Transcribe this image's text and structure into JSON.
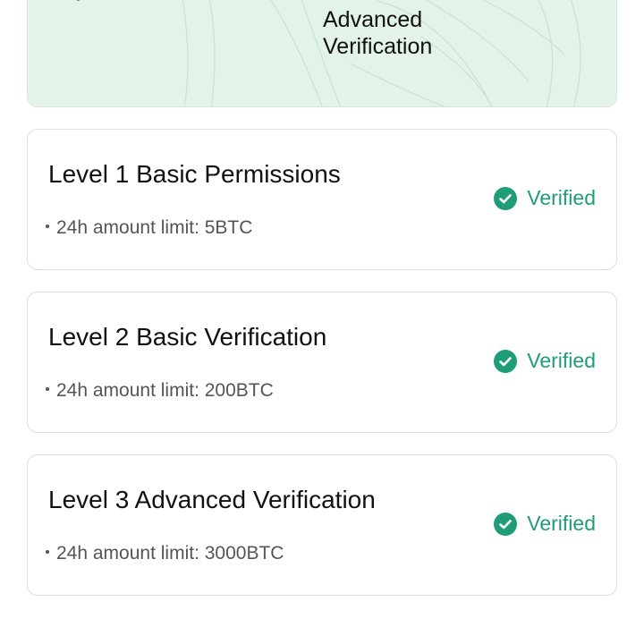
{
  "banner": {
    "partial_text": "y",
    "title_line1": "Advanced",
    "title_line2": "Verification"
  },
  "colors": {
    "accent": "#1f9d79",
    "banner_bg": "#e3f3e8"
  },
  "levels": [
    {
      "title": "Level 1 Basic Permissions",
      "limit": "24h amount limit: 5BTC",
      "status": "Verified",
      "status_icon": "check-circle-icon"
    },
    {
      "title": "Level 2 Basic Verification",
      "limit": "24h amount limit: 200BTC",
      "status": "Verified",
      "status_icon": "check-circle-icon"
    },
    {
      "title": "Level 3 Advanced Verification",
      "limit": "24h amount limit: 3000BTC",
      "status": "Verified",
      "status_icon": "check-circle-icon"
    }
  ]
}
